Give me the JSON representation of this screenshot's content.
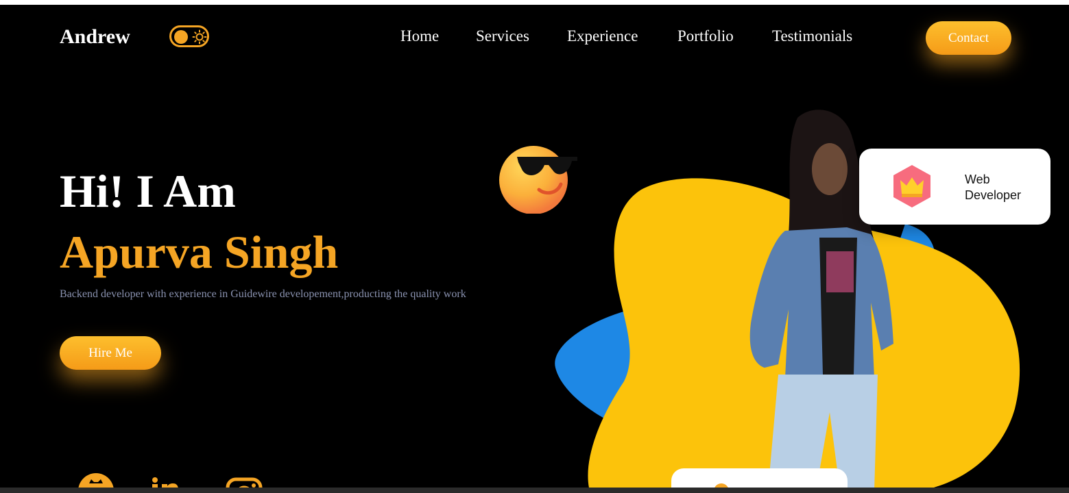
{
  "header": {
    "brand": "Andrew",
    "nav": [
      "Home",
      "Services",
      "Experience",
      "Portfolio",
      "Testimonials"
    ],
    "contact_label": "Contact",
    "theme_toggle_icon": "sun-icon"
  },
  "hero": {
    "greeting": "Hi! I Am",
    "name": "Apurva Singh",
    "description": "Backend developer with experience in Guidewire developement,producting the quality work",
    "hire_label": "Hire Me"
  },
  "badge": {
    "label_line1": "Web",
    "label_line2": "Developer",
    "icon": "crown-icon"
  },
  "social": [
    "github-icon",
    "linkedin-icon",
    "instagram-icon"
  ],
  "colors": {
    "accent": "#f5a524",
    "background": "#000000",
    "blob_yellow": "#fcc30b",
    "blob_blue": "#1e88e5",
    "description_text": "#8a92b0"
  }
}
